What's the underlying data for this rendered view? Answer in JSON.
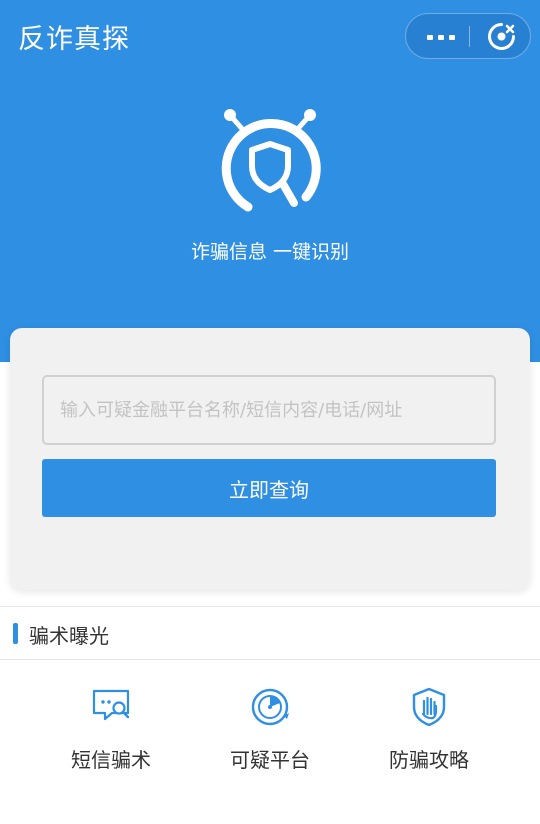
{
  "header": {
    "title": "反诈真探",
    "more_icon": "more-dots-icon",
    "close_icon": "target-close-icon"
  },
  "hero": {
    "logo_icon": "shield-magnifier-robot-icon",
    "tagline": "诈骗信息 一键识别",
    "background": "#2f8fe3"
  },
  "search": {
    "placeholder": "输入可疑金融平台名称/短信内容/电话/网址",
    "value": "",
    "button_label": "立即查询"
  },
  "section": {
    "title": "骗术曝光"
  },
  "grid": {
    "items": [
      {
        "label": "短信骗术",
        "icon": "sms-search-icon"
      },
      {
        "label": "可疑平台",
        "icon": "radar-icon"
      },
      {
        "label": "防骗攻略",
        "icon": "shield-hand-icon"
      }
    ]
  },
  "colors": {
    "accent": "#2f8fe3",
    "card": "#f1f1f1",
    "text": "#333333",
    "placeholder": "#c3c3c3"
  }
}
